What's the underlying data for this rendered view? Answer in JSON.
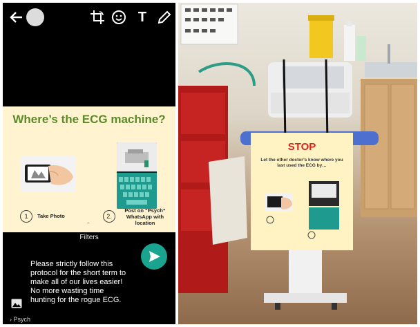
{
  "phone": {
    "slide": {
      "title": "Where’s the ECG machine?",
      "step1_number": "1",
      "step1_label": "Take Photo",
      "step2_number": "2.",
      "step2_label": "Post on “Psych” WhatsApp with location"
    },
    "filters_label": "Filters",
    "caption": "Please strictly follow this\nprotocol for the short term to\nmake all of our lives easier!\nNo more wasting time\nhunting for the rogue ECG.",
    "recipient": "Psych",
    "colors": {
      "accent": "#1aa38f",
      "slide_bg": "#fff4cf",
      "title_green": "#5a8a2a"
    }
  },
  "sign": {
    "heading": "STOP",
    "text": "Let the other doctor’s know where you last used the ECG by…",
    "heading_color": "#d5261e"
  }
}
